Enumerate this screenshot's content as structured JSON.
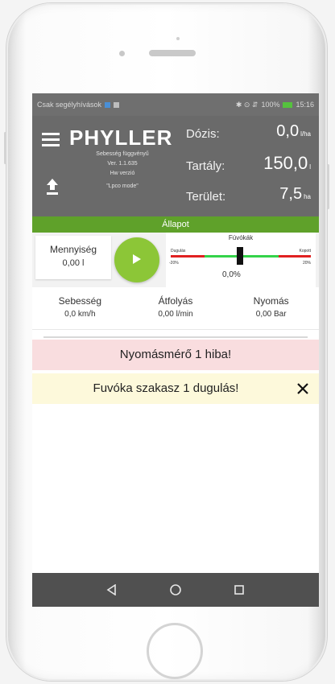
{
  "status_bar": {
    "carrier_text": "Csak segélyhívások",
    "battery_text": "100%",
    "time": "15:16"
  },
  "header": {
    "logo": "PHYLLER",
    "subtitle": "Sebesség függvényű",
    "version": "Ver. 1.1.635",
    "extra": "Hw verzió",
    "mode": "\"Lpco mode\"",
    "dose_label": "Dózis:",
    "dose_value": "0,0",
    "dose_unit": "l/ha",
    "tank_label": "Tartály:",
    "tank_value": "150,0",
    "tank_unit": "l",
    "area_label": "Terület:",
    "area_value": "7,5",
    "area_unit": "ha"
  },
  "state_bar": {
    "label": "Állapot"
  },
  "quantity": {
    "label": "Mennyiség",
    "value": "0,00 l"
  },
  "nozzles": {
    "title": "Fúvókák",
    "left_label": "Dugulás",
    "right_label": "Kopott",
    "left_pct": "-20%",
    "right_pct": "20%",
    "value": "0,0%",
    "deviation_percent": 0
  },
  "metrics": [
    {
      "label": "Sebesség",
      "value": "0,0 km/h"
    },
    {
      "label": "Átfolyás",
      "value": "0,00 l/min"
    },
    {
      "label": "Nyomás",
      "value": "0,00 Bar"
    }
  ],
  "alerts": {
    "error": "Nyomásmérő 1 hiba!",
    "warning": "Fuvóka szakasz 1 dugulás!"
  },
  "colors": {
    "accent_green": "#5fa12a",
    "play_green": "#8cc637",
    "error_bg": "#f9dddf",
    "warning_bg": "#fdf9db"
  }
}
